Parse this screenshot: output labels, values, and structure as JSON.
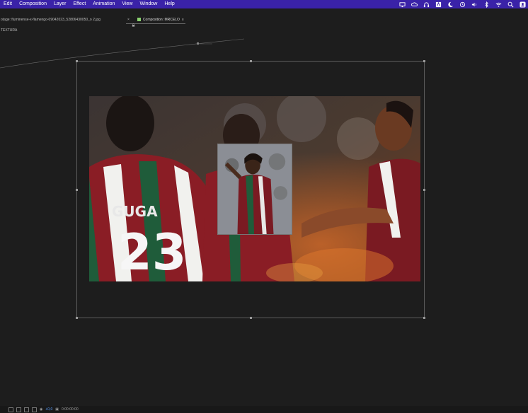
{
  "menubar": {
    "items": [
      "Edit",
      "Composition",
      "Layer",
      "Effect",
      "Animation",
      "View",
      "Window",
      "Help"
    ],
    "status_icons": [
      "display-icon",
      "cloud-sync-icon",
      "headphones-icon",
      "text-icon",
      "moon-icon",
      "time-machine-icon",
      "volume-icon",
      "bluetooth-icon",
      "wifi-icon",
      "search-icon",
      "user-icon"
    ],
    "bg_color": "#3a22a8"
  },
  "tabs": {
    "footage_tab": "otage: fluminense-x-flamengo-09042023_52806430050_o 2.jpg",
    "composition_tab": "Composition: MRCELO",
    "composition_color": "#8bd36f"
  },
  "breadcrumb": "TEXTURA",
  "bottom_toolbar": {
    "zoom": "+0,0",
    "timecode": "0:00:00:00",
    "accent_color": "#5aa0ff"
  }
}
